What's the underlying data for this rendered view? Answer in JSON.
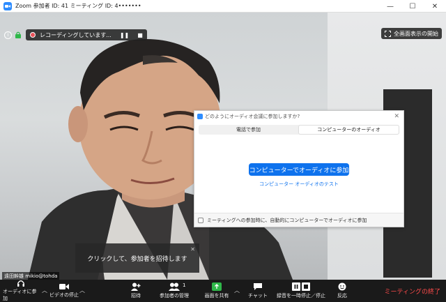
{
  "window": {
    "title": "Zoom 参加者 ID: 41 ミーティング ID: 4•••••••",
    "minimize": "—",
    "maximize": "☐",
    "close": "✕"
  },
  "recording": {
    "status_text": "レコーディングしています...",
    "pause_glyph": "❚❚",
    "stop_glyph": "■"
  },
  "fullscreen": {
    "label": "全画面表示の開始"
  },
  "audio_dialog": {
    "title": "どのようにオーディオ会議に参加しますか?",
    "tabs": [
      {
        "label": "電話で参加",
        "active": false
      },
      {
        "label": "コンピューターのオーディオ",
        "active": true
      }
    ],
    "join_button": "コンピューターでオーディオに参加",
    "test_link": "コンピューター オーディオのテスト",
    "auto_join_checkbox": "ミーティングへの参加時に、自動的にコンピューターでオーディオに参加",
    "auto_join_checked": false
  },
  "invite_tip": {
    "text": "クリックして、参加者を招待します"
  },
  "participant": {
    "name": "遠田幹雄 mikio@tohda"
  },
  "toolbar": {
    "join_audio": "オーディオに参加",
    "stop_video": "ビデオの停止",
    "invite": "招待",
    "manage_participants": "参加者の管理",
    "participant_count": "1",
    "share_screen": "画面を共有",
    "chat": "チャット",
    "pause_stop_recording": "録音を一時停止／停止",
    "reactions": "反応",
    "end_meeting": "ミーティングの終了"
  },
  "colors": {
    "accent": "#0E72ED",
    "share_green": "#2FB84A",
    "end_red": "#FF4B4B",
    "toolbar_bg": "#1A1A1A"
  }
}
